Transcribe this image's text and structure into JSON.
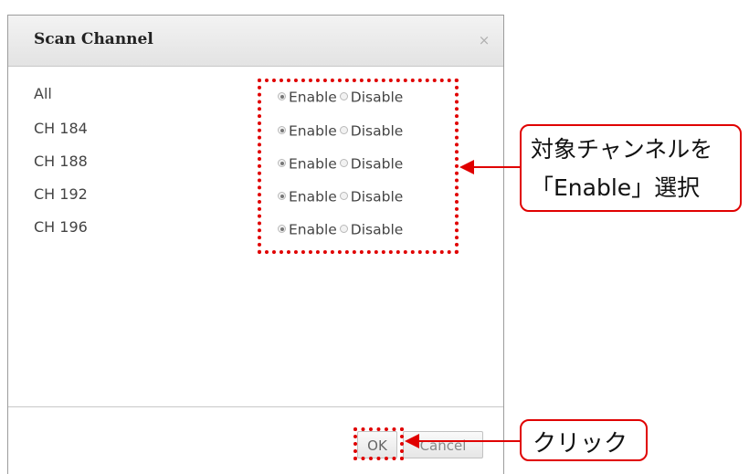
{
  "dialog": {
    "title": "Scan Channel",
    "close_icon_glyph": "×"
  },
  "channels": [
    {
      "label": "All",
      "enable_label": "Enable",
      "disable_label": "Disable",
      "selected": "enable"
    },
    {
      "label": "CH 184",
      "enable_label": "Enable",
      "disable_label": "Disable",
      "selected": "enable"
    },
    {
      "label": "CH 188",
      "enable_label": "Enable",
      "disable_label": "Disable",
      "selected": "enable"
    },
    {
      "label": "CH 192",
      "enable_label": "Enable",
      "disable_label": "Disable",
      "selected": "enable"
    },
    {
      "label": "CH 196",
      "enable_label": "Enable",
      "disable_label": "Disable",
      "selected": "enable"
    }
  ],
  "footer": {
    "ok_label": "OK",
    "cancel_label": "Cancel"
  },
  "annotations": {
    "enable_callout_line1": "対象チャンネルを",
    "enable_callout_line2": "「Enable」選択",
    "ok_callout": "クリック",
    "highlight_color": "#e00000"
  }
}
